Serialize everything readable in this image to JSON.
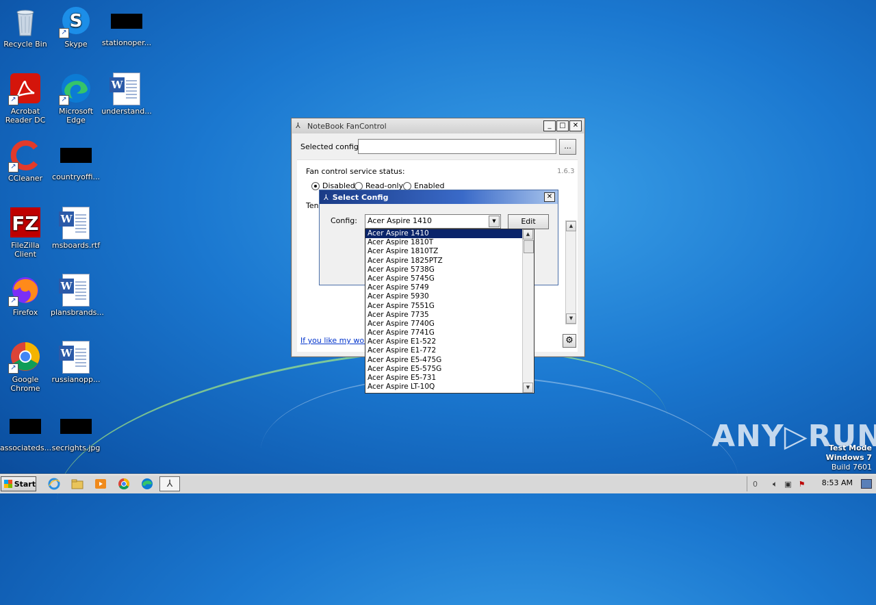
{
  "desktop": {
    "icons": [
      {
        "label": "Recycle Bin"
      },
      {
        "label": "Skype"
      },
      {
        "label": "stationoper..."
      },
      {
        "label": "Acrobat Reader DC"
      },
      {
        "label": "Microsoft Edge"
      },
      {
        "label": "understand..."
      },
      {
        "label": "CCleaner"
      },
      {
        "label": "countryoffi..."
      },
      {
        "label": "FileZilla Client"
      },
      {
        "label": "msboards.rtf"
      },
      {
        "label": "Firefox"
      },
      {
        "label": "plansbrands..."
      },
      {
        "label": "Google Chrome"
      },
      {
        "label": "russianopp..."
      },
      {
        "label": "associateds..."
      },
      {
        "label": "secrights.jpg"
      }
    ]
  },
  "main_window": {
    "title": "NoteBook FanControl",
    "minimize": "_",
    "maximize": "□",
    "close": "✕",
    "selected_config_label": "Selected config:",
    "selected_config_value": "",
    "browse_button": "...",
    "service_status_label": "Fan control service status:",
    "version": "1.6.3",
    "radio_disabled": "Disabled",
    "radio_readonly": "Read-only",
    "radio_enabled": "Enabled",
    "temp_label_partial": "Ten",
    "link_text": "If you like my work",
    "settings_icon": "⚙"
  },
  "dialog": {
    "title": "Select Config",
    "close": "✕",
    "config_label": "Config:",
    "config_value": "Acer Aspire 1410",
    "edit_button": "Edit",
    "options": [
      "Acer Aspire 1410",
      "Acer Aspire 1810T",
      "Acer Aspire 1810TZ",
      "Acer Aspire 1825PTZ",
      "Acer Aspire 5738G",
      "Acer Aspire 5745G",
      "Acer Aspire 5749",
      "Acer Aspire 5930",
      "Acer Aspire 7551G",
      "Acer Aspire 7735",
      "Acer Aspire 7740G",
      "Acer Aspire 7741G",
      "Acer Aspire E1-522",
      "Acer Aspire E1-772",
      "Acer Aspire E5-475G",
      "Acer Aspire E5-575G",
      "Acer Aspire E5-731",
      "Acer Aspire LT-10Q"
    ]
  },
  "watermark": {
    "brand": "ANY▷RUN",
    "line1": "Test Mode",
    "line2": "Windows 7",
    "line3": "Build 7601"
  },
  "taskbar": {
    "start_label": "Start",
    "clock": "8:53 AM",
    "tray_count": "0"
  }
}
